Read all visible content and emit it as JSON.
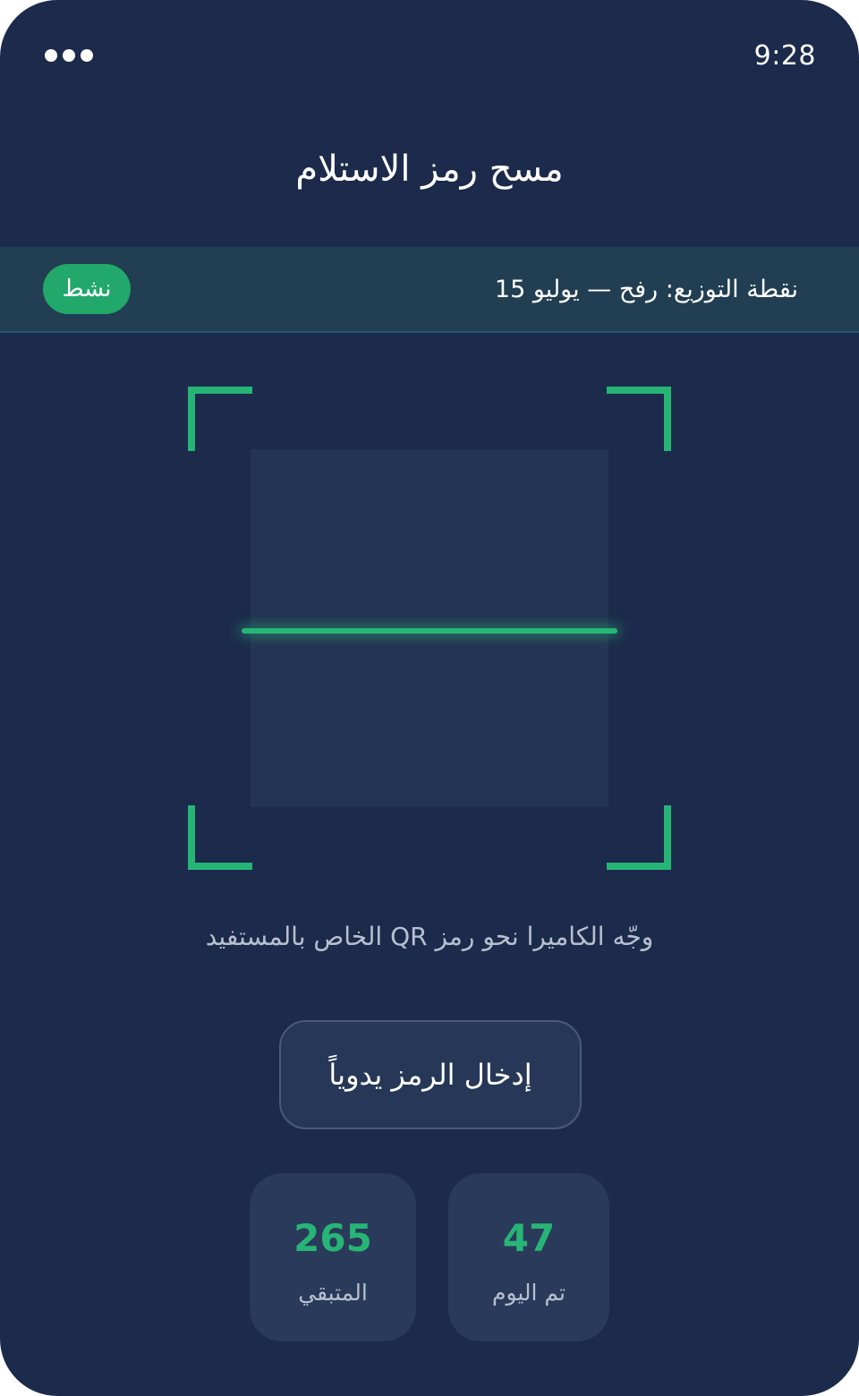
{
  "status_bar": {
    "time": "9:28"
  },
  "page": {
    "title": "مسح رمز الاستلام"
  },
  "banner": {
    "text": "نقطة التوزيع: رفح — يوليو 15",
    "status": "نشط",
    "status_color": "#22a86a"
  },
  "scanner": {
    "instruction": "وجّه الكاميرا نحو رمز QR الخاص بالمستفيد",
    "accent_color": "#27b576"
  },
  "actions": {
    "manual_entry": "إدخال الرمز يدوياً"
  },
  "stats": {
    "remaining": {
      "value": "265",
      "label": "المتبقي"
    },
    "today": {
      "value": "47",
      "label": "تم اليوم"
    }
  }
}
